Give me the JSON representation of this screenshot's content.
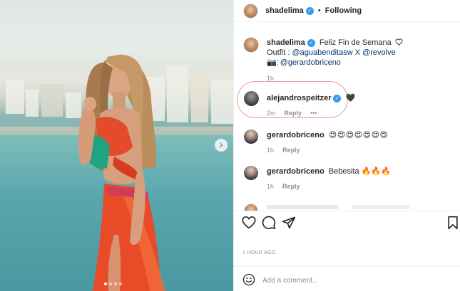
{
  "post": {
    "author": "shadelima",
    "follow_label": "Following",
    "separator": "•",
    "image_dots": {
      "count": 4,
      "active_index": 0
    }
  },
  "caption": {
    "username": "shadelima",
    "line1": "Feliz Fin de Semana",
    "line2_prefix": "Outfit : ",
    "mention1": "@aguabenditasw",
    "line2_mid": " X ",
    "mention2": "@revolve",
    "camera_emoji": "📷:",
    "mention3": "@gerardobriceno",
    "time": "1h"
  },
  "comments": [
    {
      "username": "alejandrospeitzer",
      "text": "🖤",
      "time": "2m",
      "reply": "Reply",
      "more": "•••"
    },
    {
      "username": "gerardobriceno",
      "text": "😍😍😍😍😍😍😍",
      "time": "1h",
      "reply": "Reply"
    },
    {
      "username": "gerardobriceno",
      "text": "Bebesita 🔥🔥🔥",
      "time": "1h",
      "reply": "Reply"
    }
  ],
  "actions": {
    "timestamp": "1 HOUR AGO"
  },
  "add_comment": {
    "placeholder": "Add a comment..."
  },
  "icons": {
    "verified": "verified-badge-icon",
    "like": "heart-icon",
    "comment": "comment-icon",
    "share": "share-icon",
    "save": "bookmark-icon",
    "emoji": "emoji-icon",
    "next": "chevron-right-icon"
  },
  "colors": {
    "verified": "#3897f0",
    "highlight": "#e79ab8",
    "heart_red": "#ed4956"
  }
}
